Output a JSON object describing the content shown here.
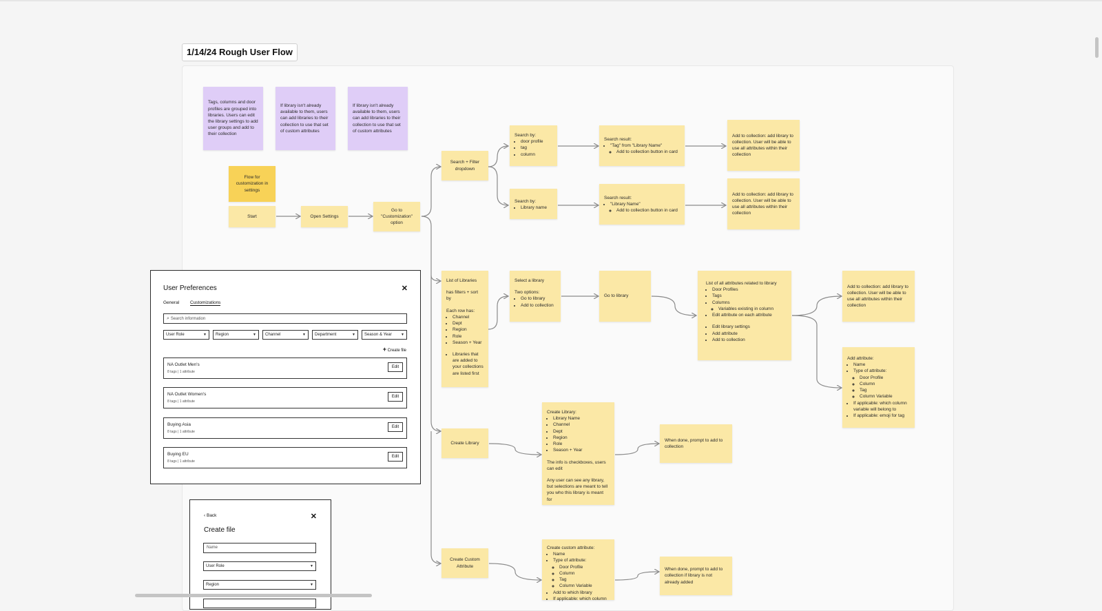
{
  "board": {
    "title": "1/14/24 Rough User Flow"
  },
  "notes": {
    "p1": "Tags, columns and door profiles are grouped into libraries. Users can edit the library settings to add user groups and add to their collection",
    "p2": "If library isn't already available to them, users can add libraries to their collection to use that set of custom attributes",
    "p3": "If library isn't already available to them, users can add libraries to their collection to use that set of custom attributes",
    "flow": "Flow for customization in settings",
    "start": "Start",
    "open": "Open Settings",
    "goto": "Go to \"Customization\" option",
    "search_filter": "Search + Filter dropdown",
    "sb1_title": "Search by:",
    "sb1_items": [
      "door profile",
      "tag",
      "column"
    ],
    "sr1_title": "Search result:",
    "sr1_item": "\"Tag\" from \"Library Name\"",
    "sr1_sub": "Add to collection button in card",
    "ac1": "Add to collection: add library to collection. User will be able to use all attributes within their collection",
    "sb2_title": "Search by:",
    "sb2_items": [
      "Library name"
    ],
    "sr2_title": "Search result:",
    "sr2_item": "\"Library Name\"",
    "sr2_sub": "Add to collection button in card",
    "ac2": "Add to collection: add library to collection. User will be able to use all attributes within their collection",
    "libs_title": "List of Libraries",
    "libs_filters": "has filters + sort by",
    "libs_row": "Each row has:",
    "libs_items": [
      "Channel",
      "Dept",
      "Region",
      "Role",
      "Season + Year"
    ],
    "libs_note": "Libraries that are added to your collections are listed first",
    "sel_title": "Select a library",
    "sel_opts": "Two options:",
    "sel_items": [
      "Go to library",
      "Add to collection"
    ],
    "gotolib": "Go to library",
    "attrs_title": "List of all attributes related to library",
    "attrs_items": [
      "Door Profiles",
      "Tags",
      "Columns"
    ],
    "attrs_sub": "Variables existing in column",
    "attrs_edit": "Edit attribute on each attribute",
    "attrs_items2": [
      "Edit library settings",
      "Add attribute",
      "Add to collection"
    ],
    "ac3": "Add to collection: add library to collection. User will be able to use all attributes within their collection",
    "aa_title": "Add attribute:",
    "aa_name": "Name",
    "aa_type": "Type of attribute:",
    "aa_types": [
      "Door Profile",
      "Column",
      "Tag",
      "Column Variable"
    ],
    "aa_if1": "If applicable: which column variable will belong to",
    "aa_if2": "If applicable: emoji for tag",
    "create_lib": "Create Library",
    "cl_title": "Create Library:",
    "cl_items": [
      "Library Name",
      "Channel",
      "Dept",
      "Region",
      "Role",
      "Season + Year"
    ],
    "cl_note1": "The info is checkboxes, users can edit",
    "cl_note2": "Any user can see any library, but selections are meant to tell you who this library is meant for",
    "done1": "When done, prompt to add to collection",
    "create_attr": "Create Custom Attribute",
    "ca_title": "Create custom attribute:",
    "ca_name": "Name",
    "ca_type": "Type of attribute:",
    "ca_types": [
      "Door Profile",
      "Column",
      "Tag",
      "Column Variable"
    ],
    "ca_add": "Add to which library",
    "ca_if": "If applicable: which column",
    "done2": "When done, prompt to add to collection if library is not already added"
  },
  "prefs": {
    "title": "User Preferences",
    "tabs": [
      "General",
      "Customizations"
    ],
    "search_placeholder": "Search information",
    "filters": [
      "User Role",
      "Region",
      "Channel",
      "Department",
      "Season & Year"
    ],
    "create": "Create file",
    "rows": [
      {
        "name": "NA Outlet Men's",
        "meta": "8 tags | 1 attribute"
      },
      {
        "name": "NA Outlet Women's",
        "meta": "8 tags | 1 attribute"
      },
      {
        "name": "Buying Asia",
        "meta": "8 tags | 1 attribute"
      },
      {
        "name": "Buying EU",
        "meta": "8 tags | 1 attribute"
      }
    ],
    "edit_label": "Edit"
  },
  "create_file": {
    "back": "Back",
    "title": "Create file",
    "name_placeholder": "Name",
    "dd1": "User Role",
    "dd2": "Region"
  },
  "colors": {
    "yellow": "#fbe8a6",
    "purple": "#dfcdf7",
    "orange": "#f8d257",
    "connector": "#8a8a8a"
  }
}
